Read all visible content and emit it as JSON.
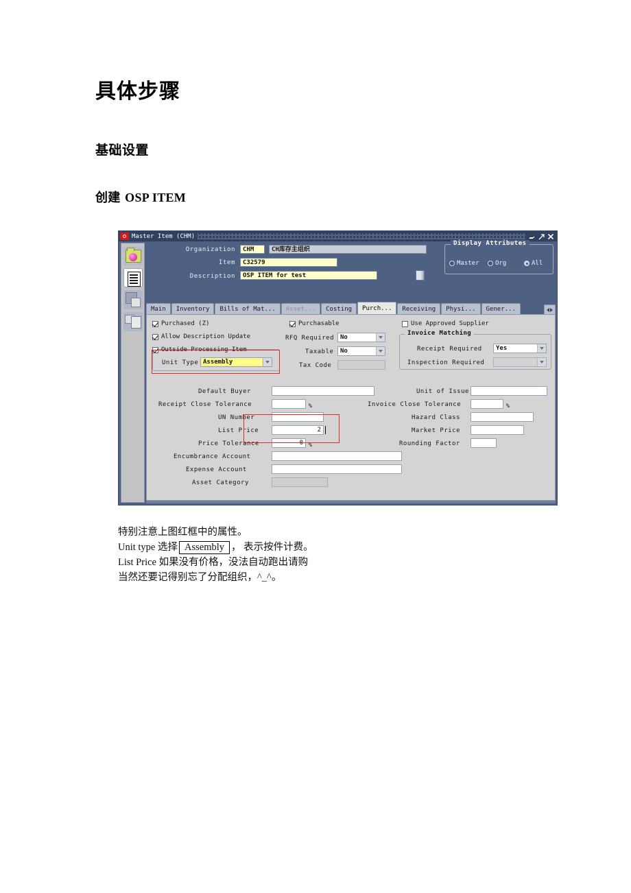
{
  "document": {
    "heading1": "具体步骤",
    "heading2": "基础设置",
    "heading3_cn": "创建 ",
    "heading3_en": "OSP ITEM",
    "notes": {
      "line1": "特别注意上图红框中的属性。",
      "line2_a": "Unit type  选择",
      "line2_box": "Assembly",
      "line2_b": "，  表示按件计费。",
      "line3": "List Price  如果没有价格，没法自动跑出请购",
      "line4": "当然还要记得别忘了分配组织，^_^。"
    }
  },
  "window": {
    "title": "Master Item (CHM)",
    "buttons": {
      "minimize": "minimize",
      "maximize": "maximize",
      "close": "close"
    }
  },
  "header": {
    "organization_label": "Organization",
    "organization_code": "CHM",
    "organization_name": "CH库存主组织",
    "item_label": "Item",
    "item_value": "C32579",
    "description_label": "Description",
    "description_value": "OSP ITEM for test",
    "display_attributes": {
      "title": "Display Attributes",
      "options": [
        {
          "label": "Master",
          "accel": "M",
          "selected": false
        },
        {
          "label": "Org",
          "accel": "O",
          "selected": false
        },
        {
          "label": "All",
          "accel": "A",
          "selected": true
        }
      ]
    }
  },
  "tabs": [
    {
      "label": "Main",
      "state": "normal"
    },
    {
      "label": "Inventory",
      "state": "normal"
    },
    {
      "label": "Bills of Mat...",
      "state": "normal"
    },
    {
      "label": "Asset...",
      "state": "disabled"
    },
    {
      "label": "Costing",
      "state": "normal"
    },
    {
      "label": "Purch...",
      "state": "active"
    },
    {
      "label": "Receiving",
      "state": "normal"
    },
    {
      "label": "Physi...",
      "state": "normal"
    },
    {
      "label": "Gener...",
      "state": "normal"
    }
  ],
  "purchasing_tab": {
    "checkboxes": [
      {
        "name": "purchased",
        "label": "Purchased (Z)",
        "checked": true
      },
      {
        "name": "allow-description-update",
        "label": "Allow Description Update",
        "checked": true
      },
      {
        "name": "outside-processing-item",
        "label": "Outside Processing Item",
        "checked": true
      },
      {
        "name": "purchasable",
        "label": "Purchasable",
        "checked": true
      },
      {
        "name": "use-approved-supplier",
        "label": "Use Approved Supplier",
        "checked": false
      }
    ],
    "unit_type": {
      "label": "Unit Type",
      "value": "Assembly"
    },
    "rfq_required": {
      "label": "RFQ Required",
      "value": "No"
    },
    "taxable": {
      "label": "Taxable",
      "value": "No"
    },
    "tax_code": {
      "label": "Tax Code",
      "value": ""
    },
    "invoice_matching": {
      "title": "Invoice Matching",
      "receipt_required": {
        "label": "Receipt Required",
        "value": "Yes"
      },
      "inspection_required": {
        "label": "Inspection Required",
        "value": ""
      }
    },
    "left_fields": [
      {
        "name": "default-buyer",
        "label": "Default Buyer",
        "value": "",
        "suffix": ""
      },
      {
        "name": "receipt-close-tolerance",
        "label": "Receipt Close Tolerance",
        "value": "",
        "suffix": "%"
      },
      {
        "name": "un-number",
        "label": "UN Number",
        "value": "",
        "suffix": ""
      },
      {
        "name": "list-price",
        "label": "List Price",
        "value": "2",
        "suffix": ""
      },
      {
        "name": "price-tolerance",
        "label": "Price Tolerance",
        "value": "0",
        "suffix": "%"
      },
      {
        "name": "encumbrance-account",
        "label": "Encumbrance Account",
        "value": "",
        "suffix": ""
      },
      {
        "name": "expense-account",
        "label": "Expense Account",
        "value": "",
        "suffix": ""
      },
      {
        "name": "asset-category",
        "label": "Asset Category",
        "value": "",
        "suffix": ""
      }
    ],
    "right_fields": [
      {
        "name": "unit-of-issue",
        "label": "Unit of Issue",
        "value": "",
        "suffix": ""
      },
      {
        "name": "invoice-close-tolerance",
        "label": "Invoice Close Tolerance",
        "value": "",
        "suffix": "%"
      },
      {
        "name": "hazard-class",
        "label": "Hazard Class",
        "value": "",
        "suffix": ""
      },
      {
        "name": "market-price",
        "label": "Market Price",
        "value": "",
        "suffix": ""
      },
      {
        "name": "rounding-factor",
        "label": "Rounding Factor",
        "value": "",
        "suffix": ""
      }
    ]
  },
  "colors": {
    "window_frame": "#4f6183",
    "titlebar": "#31405e",
    "panel_bg": "#d4d4d4",
    "field_yellow": "#ffffcc",
    "annotation_red": "#e8272c"
  }
}
